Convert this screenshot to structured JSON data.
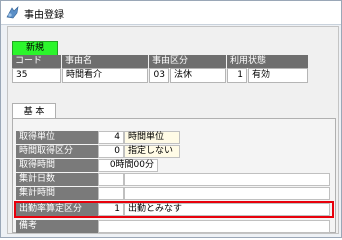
{
  "window": {
    "title": "事由登録"
  },
  "badge": {
    "new_label": "新規"
  },
  "header_columns": [
    "コード",
    "事由名",
    "事由区分",
    "利用状態"
  ],
  "record": {
    "code": "35",
    "name": "時間看介",
    "kubun_code": "03",
    "kubun_name": "法休",
    "status_code": "1",
    "status_name": "有効"
  },
  "tabs": {
    "basic": "基 本"
  },
  "fields": {
    "unit_label": "取得単位",
    "unit_num": "4",
    "unit_text": "時間単位",
    "time_kubun_label": "時間取得区分",
    "time_kubun_num": "0",
    "time_kubun_text": "指定しない",
    "time_label": "取得時間",
    "time_value": "0時間00分",
    "days_label": "集計日数",
    "hours_label": "集計時間",
    "attend_label": "出勤率算定区分",
    "attend_num": "1",
    "attend_text": "出勤とみなす",
    "note_label": "備考"
  },
  "colors": {
    "badge_green": "#2cf52c",
    "highlight_red": "#e8000b",
    "header_gray": "#6e6e6e"
  }
}
